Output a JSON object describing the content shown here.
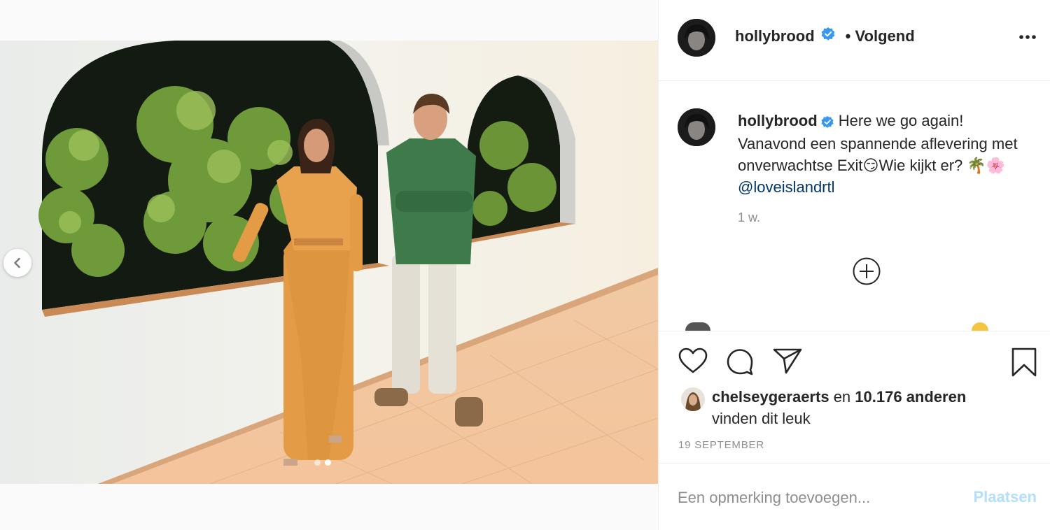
{
  "post": {
    "username": "hollybrood",
    "follow_status": "Volgend",
    "caption_text": "Here we go again! Vanavond een spannende aflevering met onverwachtse Exit😏Wie kijkt er? 🌴🌸",
    "mention": "@loveislandrtl",
    "time_ago": "1 w.",
    "likes": {
      "first_liker": "chelseygeraerts",
      "connector": "en",
      "others": "10.176 anderen",
      "suffix": "vinden dit leuk"
    },
    "date": "19 SEPTEMBER"
  },
  "carousel": {
    "total": 2,
    "active_index": 1
  },
  "comment_box": {
    "placeholder": "Een opmerking toevoegen...",
    "submit_label": "Plaatsen"
  },
  "icons": {
    "prev": "chevron-left-icon",
    "more": "more-options-icon",
    "verified": "verified-badge-icon",
    "load_more": "plus-circle-icon",
    "like": "heart-icon",
    "comment": "comment-bubble-icon",
    "share": "paper-plane-icon",
    "save": "bookmark-icon"
  },
  "colors": {
    "verified": "#3897f0",
    "mention": "#00376b",
    "submit_disabled": "#b2dffc",
    "muted": "#8e8e8e"
  }
}
